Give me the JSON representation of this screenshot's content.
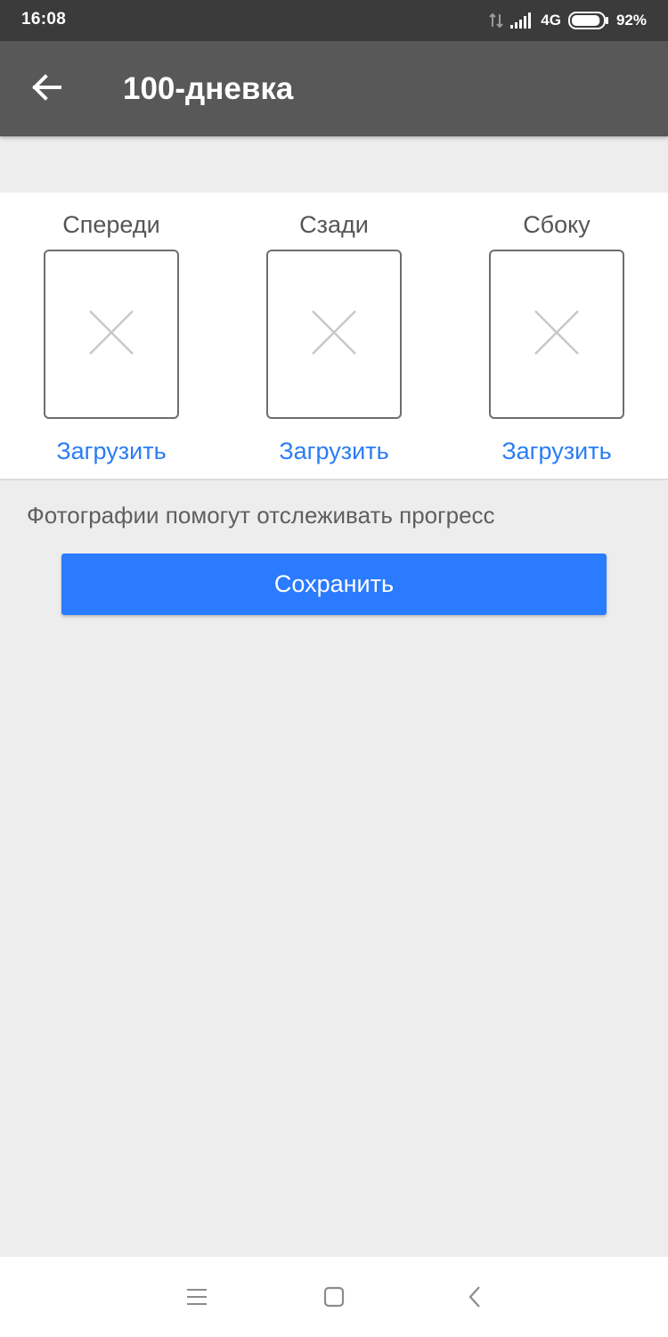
{
  "status_bar": {
    "time": "16:08",
    "network": "4G",
    "battery": "92%",
    "battery_level": 0.92,
    "icons": [
      "data-transfer-icon",
      "signal-icon",
      "battery-icon"
    ]
  },
  "app_bar": {
    "title": "100-дневка",
    "back_icon": "arrow-left-icon",
    "background_color": "#585858"
  },
  "photos": [
    {
      "label": "Спереди",
      "upload_label": "Загрузить",
      "placeholder_icon": "close-icon"
    },
    {
      "label": "Сзади",
      "upload_label": "Загрузить",
      "placeholder_icon": "close-icon"
    },
    {
      "label": "Сбоку",
      "upload_label": "Загрузить",
      "placeholder_icon": "close-icon"
    }
  ],
  "hint": "Фотографии помогут отслеживать прогресс",
  "save_button": {
    "label": "Сохранить",
    "color": "#2b7bff"
  },
  "link_color": "#2a7df3",
  "nav_bar": {
    "icons": [
      "menu-icon",
      "home-square-icon",
      "back-chevron-icon"
    ]
  }
}
